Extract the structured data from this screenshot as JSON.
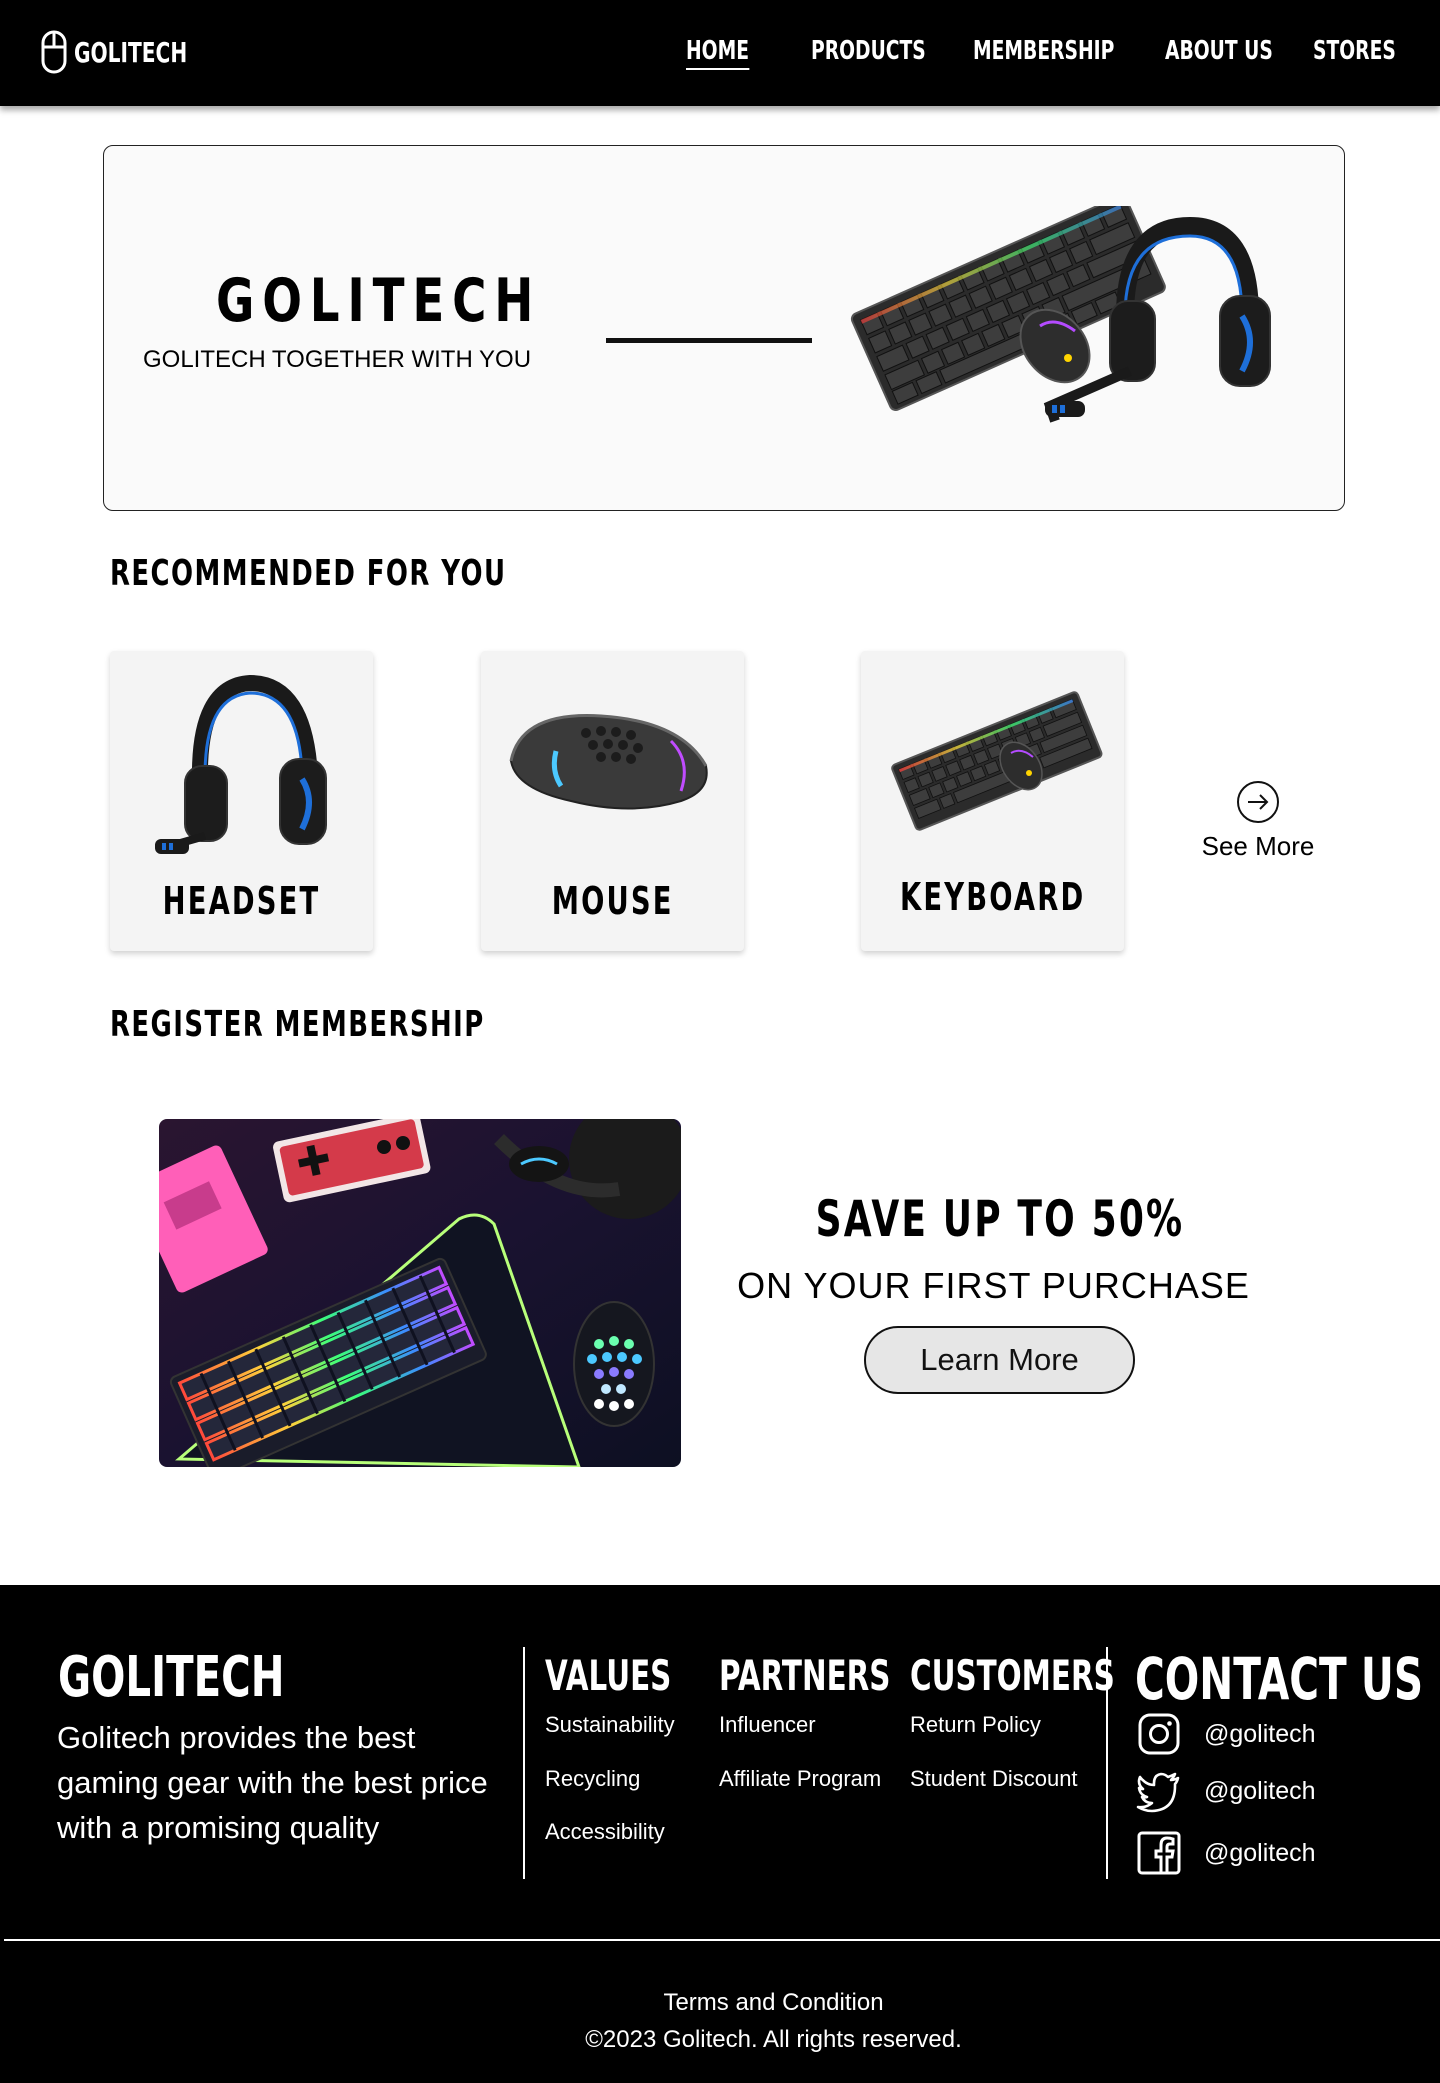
{
  "nav": {
    "brand": "GOLITECH",
    "links": [
      "HOME",
      "PRODUCTS",
      "MEMBERSHIP",
      "ABOUT US",
      "STORES"
    ],
    "active": "HOME"
  },
  "hero": {
    "title": "GOLITECH",
    "subtitle": "GOLITECH TOGETHER WITH YOU"
  },
  "recommended": {
    "title": "RECOMMENDED FOR YOU",
    "items": [
      {
        "label": "HEADSET",
        "icon": "headset-image"
      },
      {
        "label": "MOUSE",
        "icon": "mouse-image"
      },
      {
        "label": "KEYBOARD",
        "icon": "keyboard-image"
      }
    ],
    "see_more": "See More"
  },
  "membership": {
    "title": "REGISTER MEMBERSHIP",
    "headline": "SAVE UP TO 50%",
    "subline": "ON YOUR FIRST PURCHASE",
    "button": "Learn More"
  },
  "footer": {
    "brand": "GOLITECH",
    "description": "Golitech provides the best gaming gear with the best price with a promising quality",
    "columns": [
      {
        "title": "VALUES",
        "links": [
          "Sustainability",
          "Recycling",
          "Accessibility"
        ]
      },
      {
        "title": "PARTNERS",
        "links": [
          "Influencer",
          "Affiliate Program"
        ]
      },
      {
        "title": "CUSTOMERS",
        "links": [
          "Return Policy",
          "Student Discount"
        ]
      }
    ],
    "contact_title": "CONTACT US",
    "socials": [
      {
        "icon": "instagram-icon",
        "handle": "@golitech"
      },
      {
        "icon": "twitter-icon",
        "handle": "@golitech"
      },
      {
        "icon": "facebook-icon",
        "handle": "@golitech"
      }
    ],
    "terms": "Terms and Condition",
    "copyright": "©2023 Golitech. All rights reserved."
  },
  "colors": {
    "nav_bg": "#000000",
    "footer_bg": "#000000",
    "card_bg": "#f4f4f4",
    "accent_blue": "#1e6fd9"
  }
}
